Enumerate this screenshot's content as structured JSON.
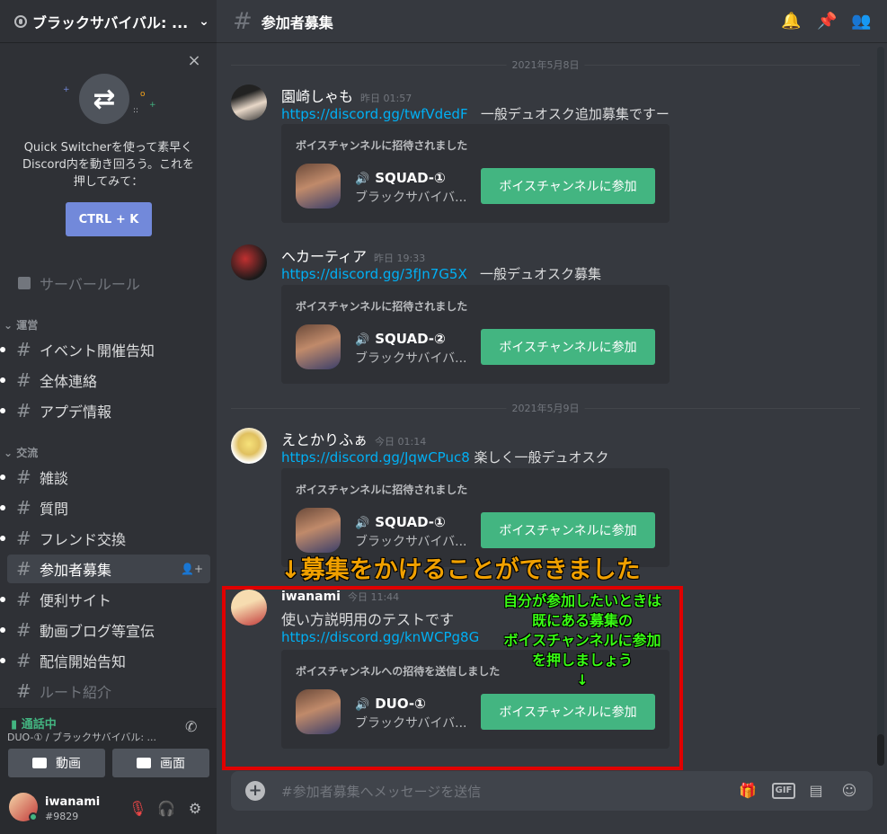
{
  "server": {
    "name": "ブラックサバイバル: ..."
  },
  "quick_switcher": {
    "close": "×",
    "text_lines": [
      "Quick Switcherを使って素早く",
      "Discord内を動き回ろう。これを",
      "押してみて："
    ],
    "button": "CTRL + K"
  },
  "channels": {
    "rules": "サーバールール",
    "cat1": "運営",
    "cat1_items": [
      "イベント開催告知",
      "全体連絡",
      "アプデ情報"
    ],
    "cat2": "交流",
    "cat2_items": [
      "雑談",
      "質問",
      "フレンド交換",
      "参加者募集",
      "便利サイト",
      "動画ブログ等宣伝",
      "配信開始告知"
    ],
    "muted_item": "ルート紹介"
  },
  "voice": {
    "status": "通話中",
    "channel": "DUO-① / ブラックサバイバル: ...",
    "video": "動画",
    "screen": "画面"
  },
  "user": {
    "name": "iwanami",
    "tag": "#9829"
  },
  "header": {
    "channel": "参加者募集"
  },
  "dividers": [
    "2021年5月8日",
    "2021年5月9日"
  ],
  "messages": [
    {
      "author": "園崎しゃも",
      "time": "昨日 01:57",
      "link": "https://discord.gg/twfVdedF",
      "text": "一般デュオスク追加募集ですー",
      "invite": {
        "title": "ボイスチャンネルに招待されました",
        "name": "SQUAD-①",
        "server": "ブラックサバイバ...",
        "join": "ボイスチャンネルに参加"
      }
    },
    {
      "author": "ヘカーティア",
      "time": "昨日 19:33",
      "link": "https://discord.gg/3fJn7G5X",
      "text": "一般デュオスク募集",
      "invite": {
        "title": "ボイスチャンネルに招待されました",
        "name": "SQUAD-②",
        "server": "ブラックサバイバ...",
        "join": "ボイスチャンネルに参加"
      }
    },
    {
      "author": "えとかりふぁ",
      "time": "今日 01:14",
      "link": "https://discord.gg/JqwCPuc8",
      "text": "楽しく一般デュオスク",
      "invite": {
        "title": "ボイスチャンネルに招待されました",
        "name": "SQUAD-①",
        "server": "ブラックサバイバ...",
        "join": "ボイスチャンネルに参加"
      }
    },
    {
      "author": "iwanami",
      "time": "今日 11:44",
      "text": "使い方説明用のテストです",
      "link": "https://discord.gg/knWCPg8G",
      "invite": {
        "title": "ボイスチャンネルへの招待を送信しました",
        "name": "DUO-①",
        "server": "ブラックサバイバ...",
        "join": "ボイスチャンネルに参加"
      }
    }
  ],
  "composer": {
    "placeholder": "#参加者募集へメッセージを送信",
    "gif": "GIF"
  },
  "annotations": {
    "title": "↓募集をかけることができました",
    "green_lines": [
      "自分が参加したいときは",
      "既にある募集の",
      "ボイスチャンネルに参加",
      "を押しましょう",
      "↓"
    ]
  }
}
